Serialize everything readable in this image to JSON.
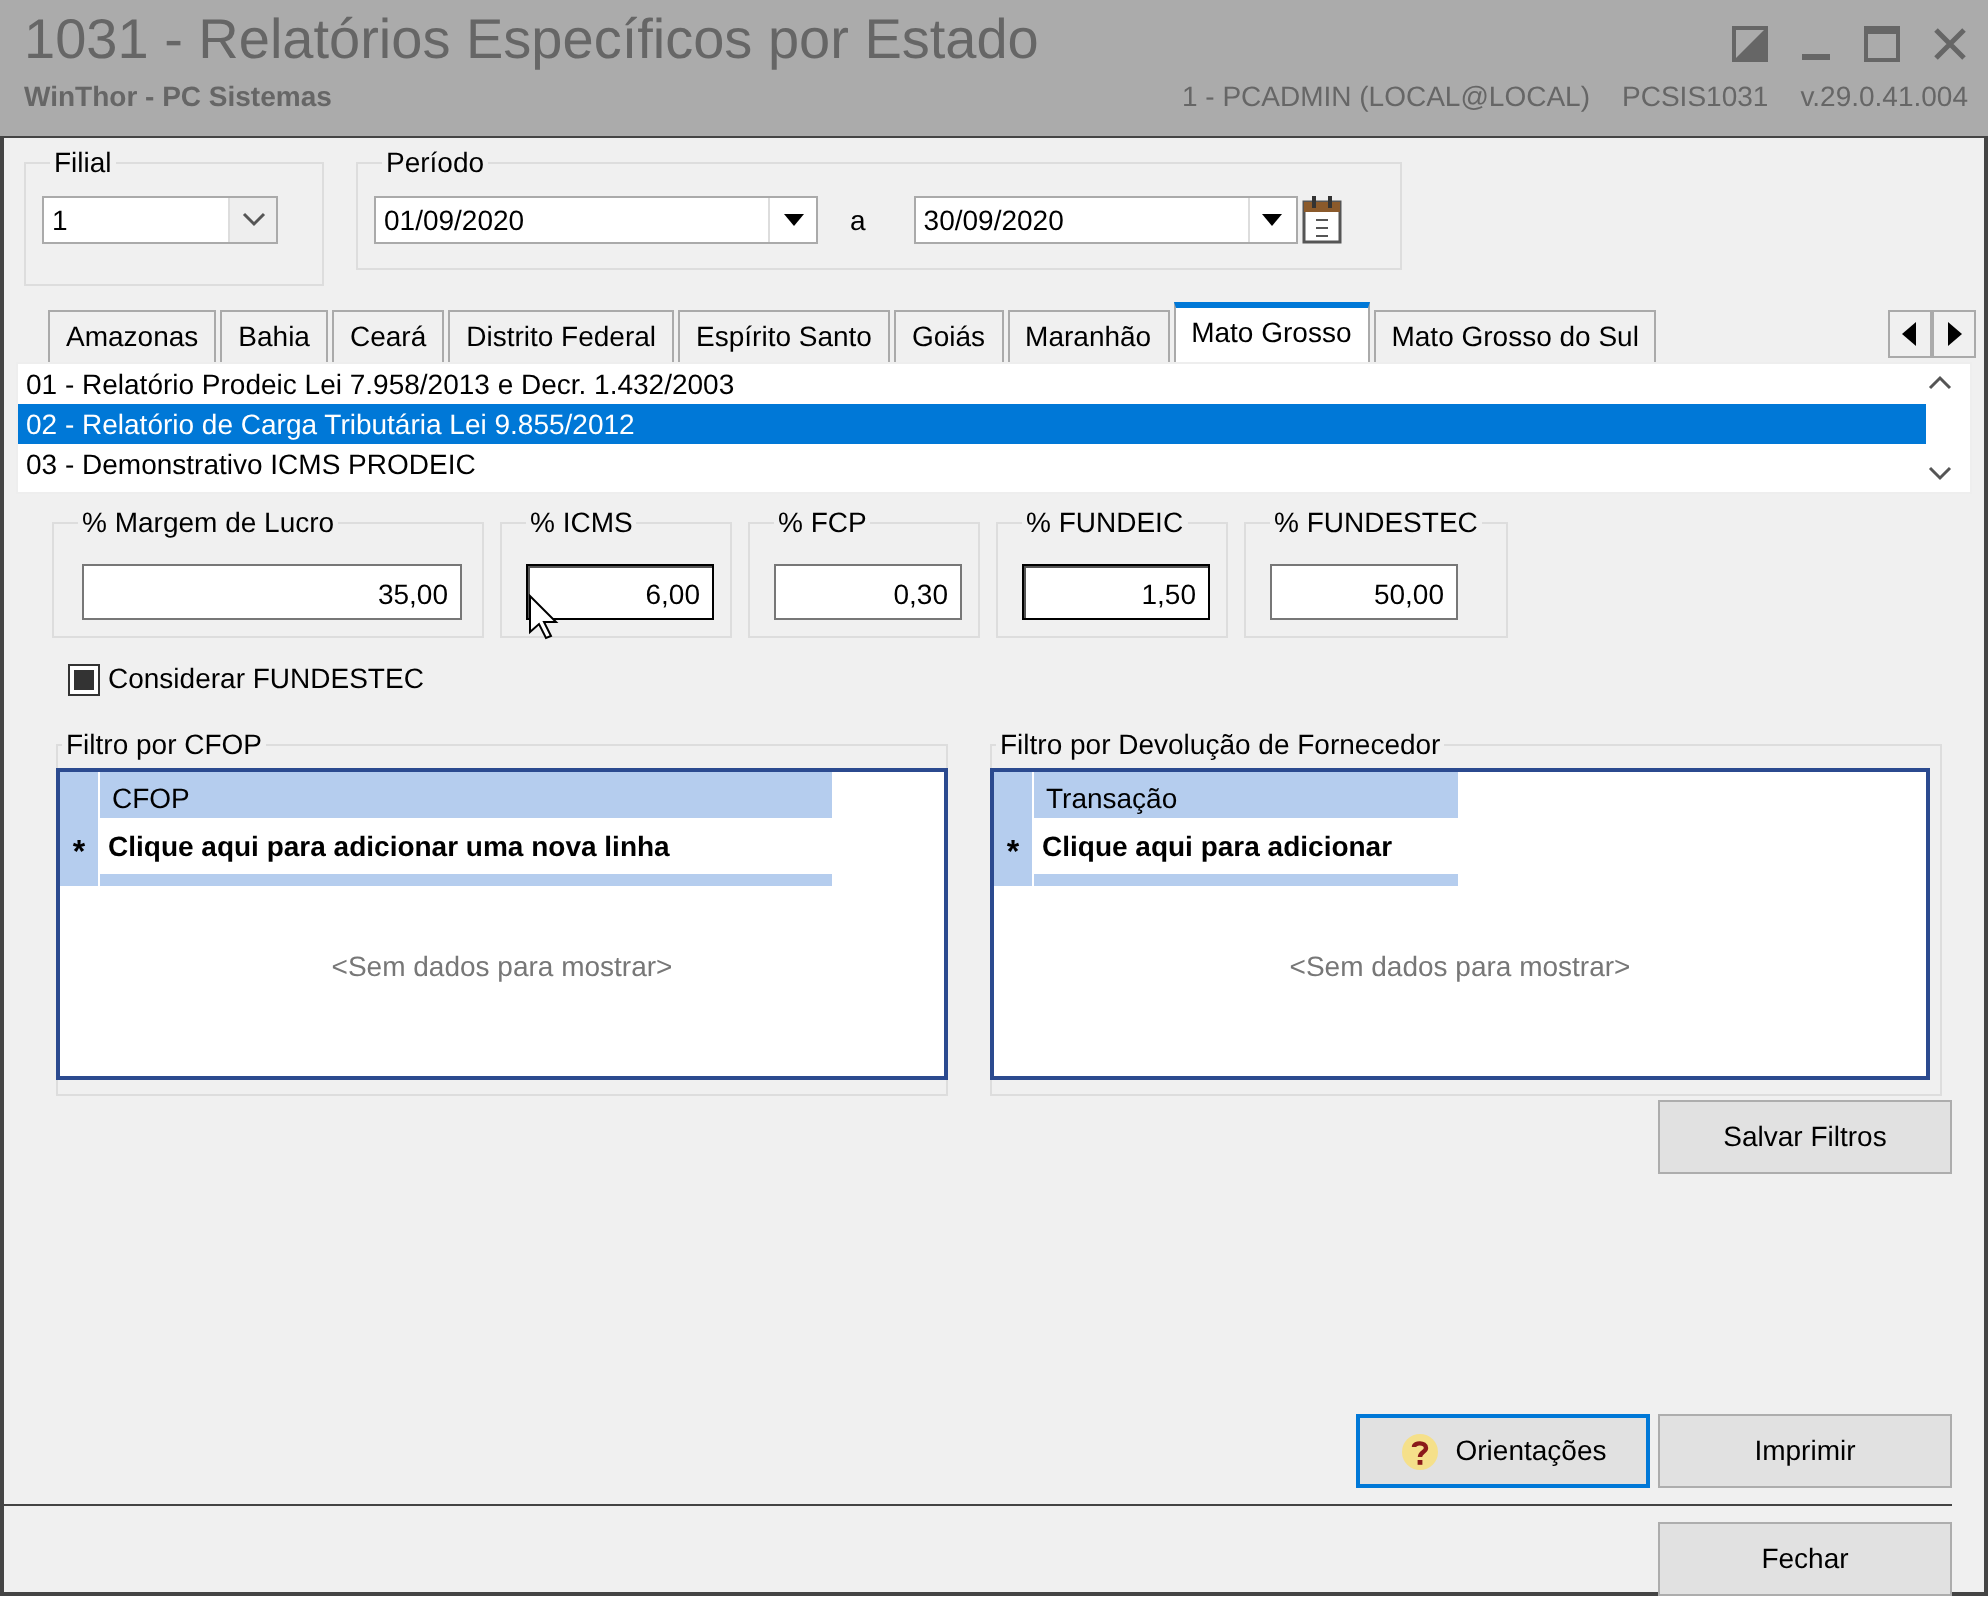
{
  "window": {
    "title": "1031 - Relatórios Específicos por Estado",
    "subtitle": "WinThor - PC Sistemas",
    "user_info": "1 - PCADMIN (LOCAL@LOCAL)",
    "program": "PCSIS1031",
    "version": "v.29.0.41.004"
  },
  "filial": {
    "label": "Filial",
    "value": "1"
  },
  "periodo": {
    "label": "Período",
    "from": "01/09/2020",
    "separator": "a",
    "to": "30/09/2020"
  },
  "tabs": [
    {
      "label": "Amazonas",
      "selected": false
    },
    {
      "label": "Bahia",
      "selected": false
    },
    {
      "label": "Ceará",
      "selected": false
    },
    {
      "label": "Distrito Federal",
      "selected": false
    },
    {
      "label": "Espírito Santo",
      "selected": false
    },
    {
      "label": "Goiás",
      "selected": false
    },
    {
      "label": "Maranhão",
      "selected": false
    },
    {
      "label": "Mato Grosso",
      "selected": true
    },
    {
      "label": "Mato Grosso do Sul",
      "selected": false
    }
  ],
  "reports": [
    {
      "label": "01 - Relatório Prodeic Lei 7.958/2013 e Decr. 1.432/2003",
      "selected": false
    },
    {
      "label": "02 - Relatório de Carga Tributária Lei 9.855/2012",
      "selected": true
    },
    {
      "label": "03 - Demonstrativo ICMS PRODEIC",
      "selected": false
    }
  ],
  "fields": [
    {
      "label": "% Margem de Lucro",
      "value": "35,00"
    },
    {
      "label": "% ICMS",
      "value": "6,00"
    },
    {
      "label": "% FCP",
      "value": "0,30"
    },
    {
      "label": "% FUNDEIC",
      "value": "1,50"
    },
    {
      "label": "% FUNDESTEC",
      "value": "50,00"
    }
  ],
  "considerar": {
    "label": "Considerar FUNDESTEC",
    "checked": true
  },
  "filters": [
    {
      "title": "Filtro por CFOP",
      "column": "CFOP",
      "new_row": "Clique aqui para adicionar uma nova linha",
      "empty": "<Sem dados para mostrar>"
    },
    {
      "title": "Filtro por Devolução de Fornecedor",
      "column": "Transação",
      "new_row": "Clique aqui para adicionar",
      "empty": "<Sem dados para mostrar>"
    }
  ],
  "new_row_marker": "*",
  "buttons": {
    "save": "Salvar Filtros",
    "help": "Orientações",
    "print": "Imprimir",
    "close": "Fechar"
  }
}
